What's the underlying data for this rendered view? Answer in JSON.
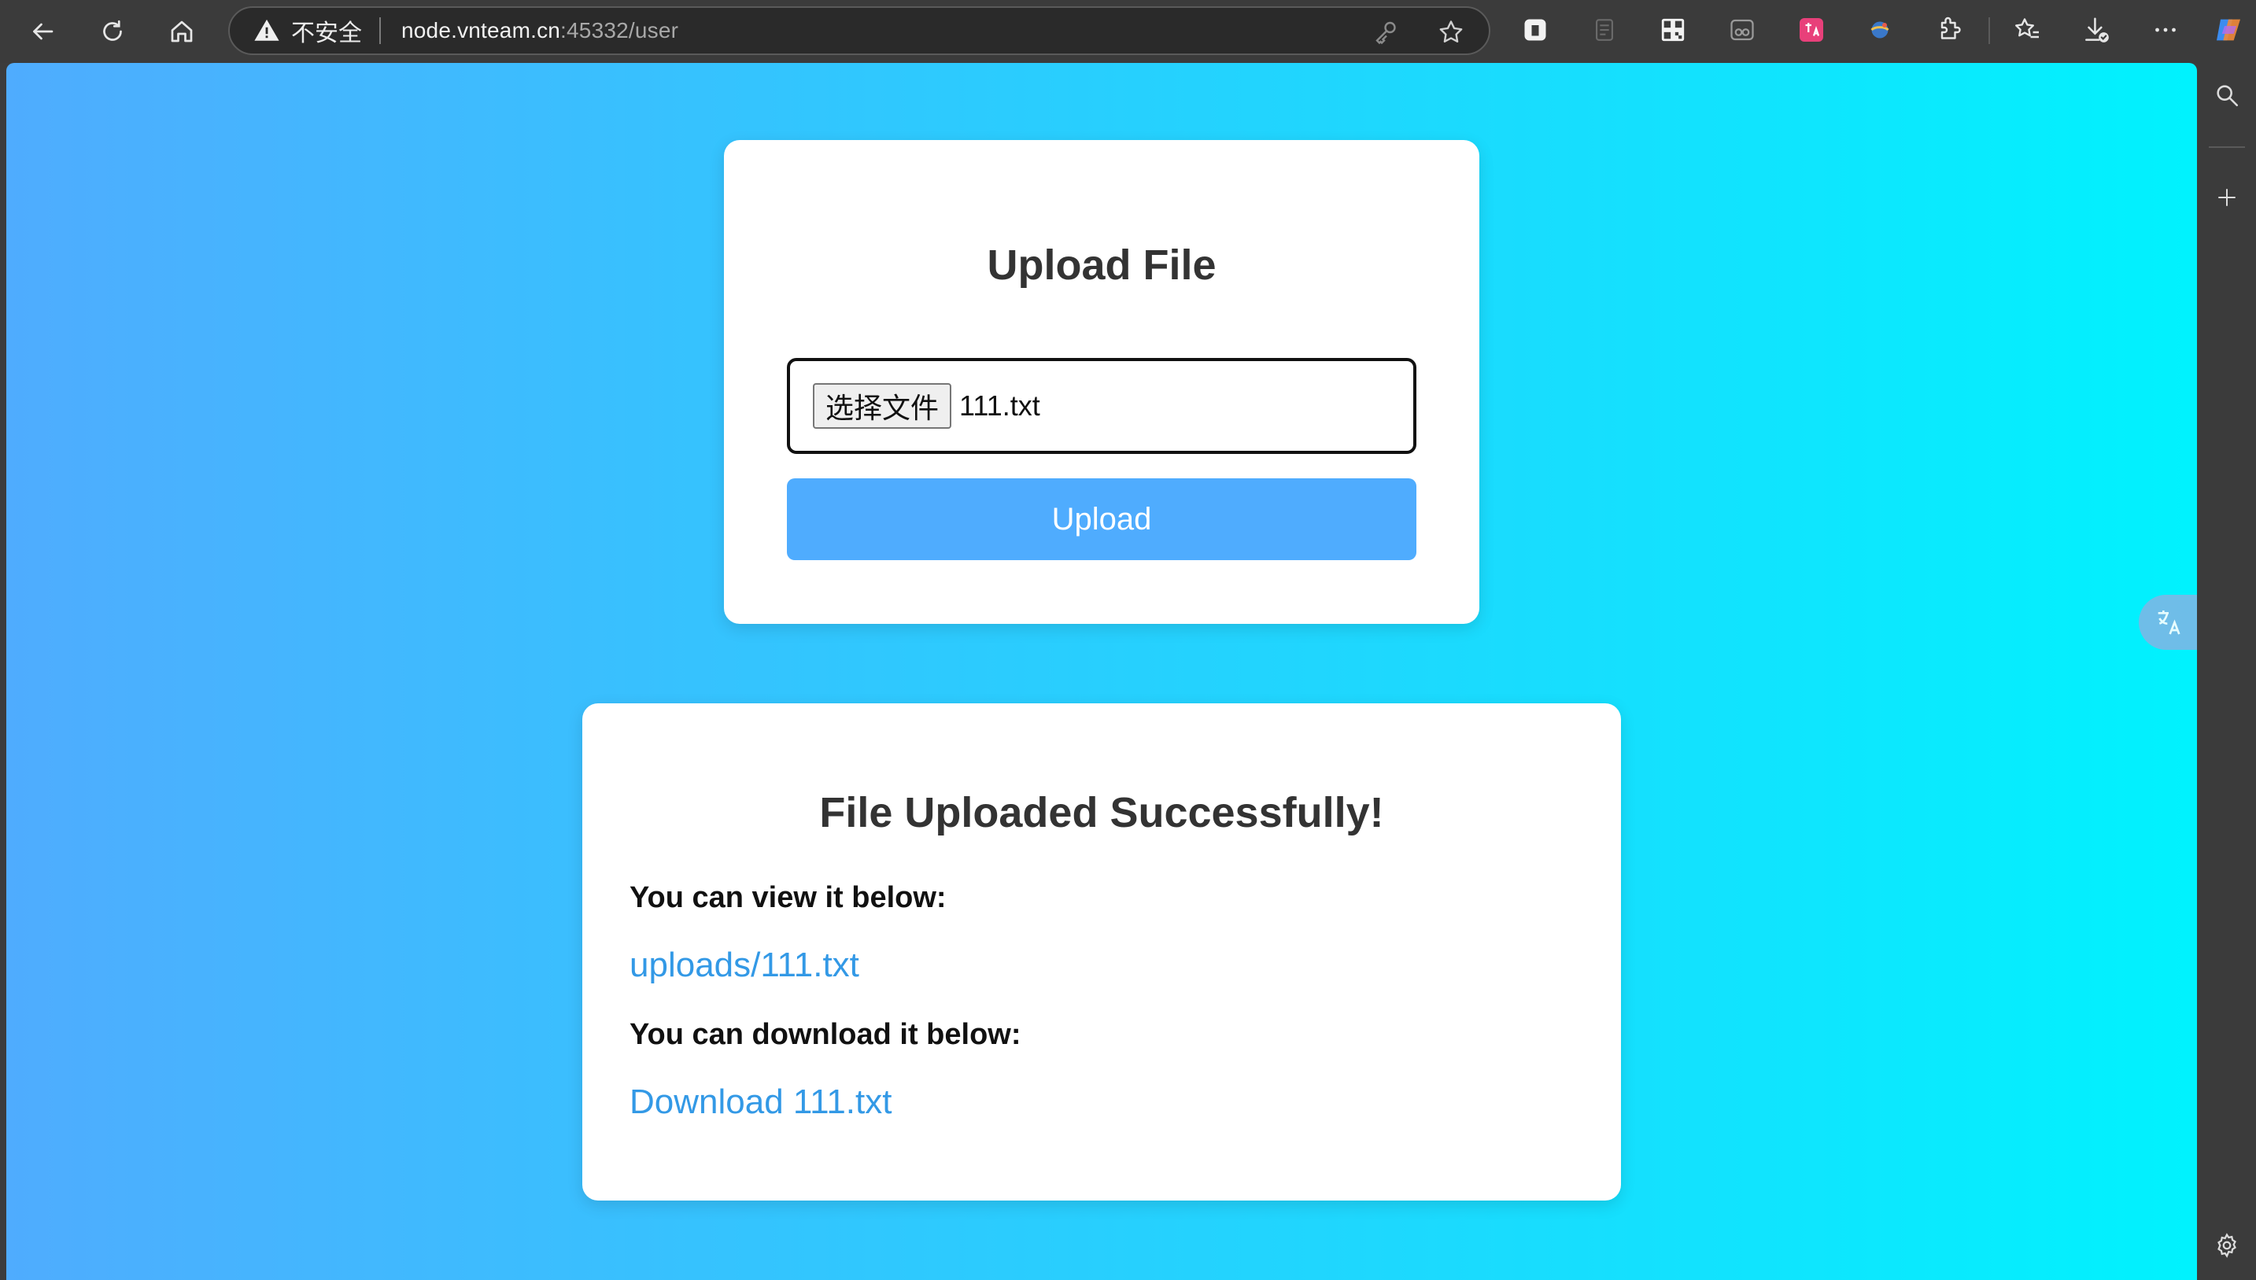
{
  "browser": {
    "address_bar": {
      "security_label": "不安全",
      "url_host": "node.vnteam.cn",
      "url_rest": ":45332/user"
    },
    "icons": {
      "back": "back-arrow-icon",
      "refresh": "refresh-icon",
      "home": "home-icon",
      "warning": "warning-icon",
      "password": "key-icon",
      "favorite": "star-icon",
      "extensions": [
        "ext-translate-icon",
        "ext-pdf-icon",
        "ext-qrcode-icon",
        "ext-glasses-icon",
        "ext-pink-translate-icon",
        "ext-globe-icon",
        "extensions-puzzle-icon"
      ],
      "favorites_bar": "favorites-icon",
      "downloads": "downloads-icon",
      "menu": "more-menu-icon",
      "copilot": "copilot-icon"
    },
    "side_panel": [
      "search-icon",
      "add-icon",
      "settings-icon"
    ]
  },
  "page": {
    "upload_card": {
      "title": "Upload File",
      "choose_file_label": "选择文件",
      "selected_file": "111.txt",
      "upload_button": "Upload"
    },
    "result_card": {
      "title": "File Uploaded Successfully!",
      "view_text": "You can view it below:",
      "view_link": "uploads/111.txt",
      "download_text": "You can download it below:",
      "download_link": "Download 111.txt"
    }
  },
  "colors": {
    "gradient_start": "#4facfe",
    "gradient_end": "#00f2fe",
    "button": "#4facfe",
    "link": "#3399e6",
    "chrome": "#3b3b3b"
  }
}
